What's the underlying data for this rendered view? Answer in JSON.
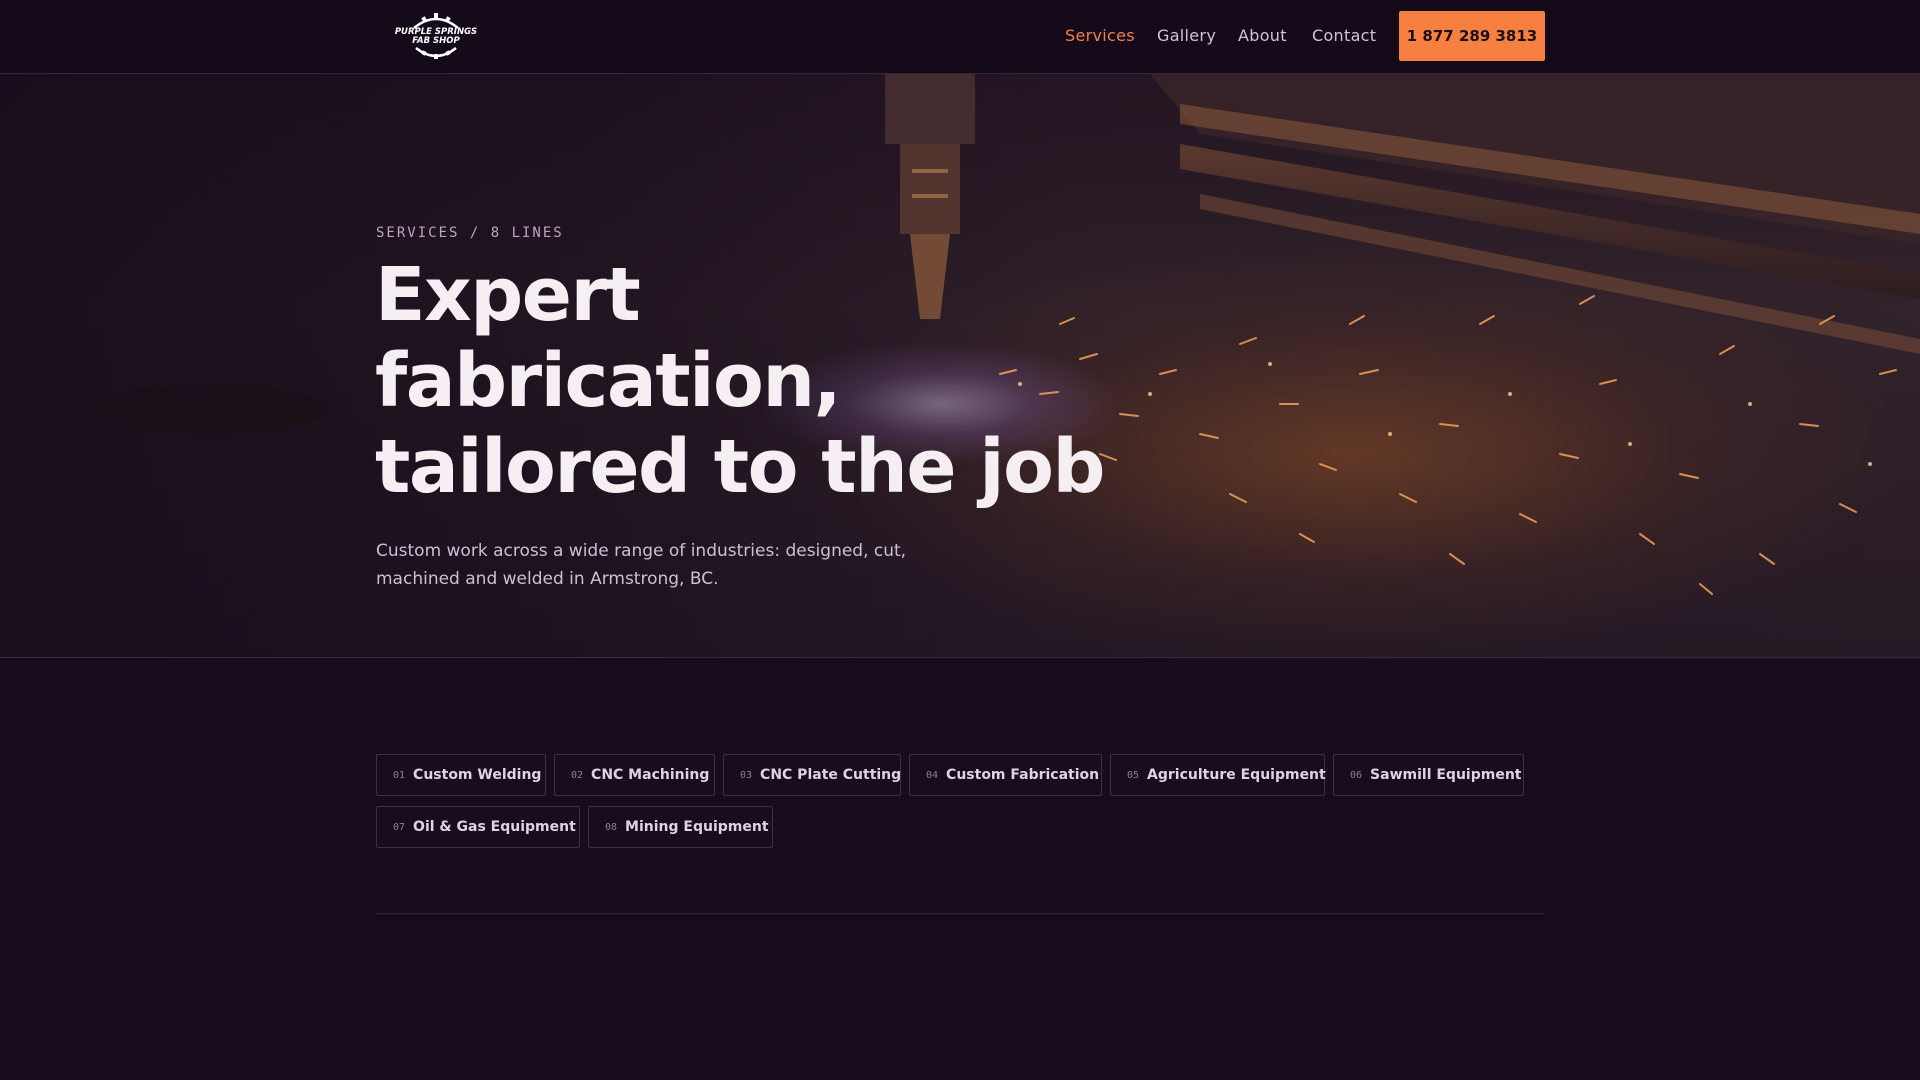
{
  "header": {
    "logo": {
      "line1": "PURPLE SPRINGS",
      "line2": "FAB SHOP",
      "icon": "gear-logo-icon"
    },
    "nav": [
      {
        "label": "Services",
        "active": true
      },
      {
        "label": "Gallery",
        "active": false
      },
      {
        "label": "About",
        "active": false
      },
      {
        "label": "Contact",
        "active": false
      }
    ],
    "phone_label": "1 877 289 3813"
  },
  "hero": {
    "eyebrow": "SERVICES / 8 LINES",
    "title_line1": "Expert",
    "title_line2": "fabrication,",
    "title_line3": "tailored to the job",
    "subtitle": "Custom work across a wide range of industries: designed, cut, machined and welded in Armstrong, BC.",
    "background": "plasma-cutting-sparks-image"
  },
  "services": [
    {
      "num": "01",
      "label": "Custom Welding"
    },
    {
      "num": "02",
      "label": "CNC Machining"
    },
    {
      "num": "03",
      "label": "CNC Plate Cutting"
    },
    {
      "num": "04",
      "label": "Custom Fabrication"
    },
    {
      "num": "05",
      "label": "Agriculture Equipment"
    },
    {
      "num": "06",
      "label": "Sawmill Equipment"
    },
    {
      "num": "07",
      "label": "Oil & Gas Equipment"
    },
    {
      "num": "08",
      "label": "Mining Equipment"
    }
  ],
  "colors": {
    "background": "#170c1b",
    "accent": "#f77f3f",
    "nav_active": "#f0814a",
    "text": "#f5eef3"
  }
}
